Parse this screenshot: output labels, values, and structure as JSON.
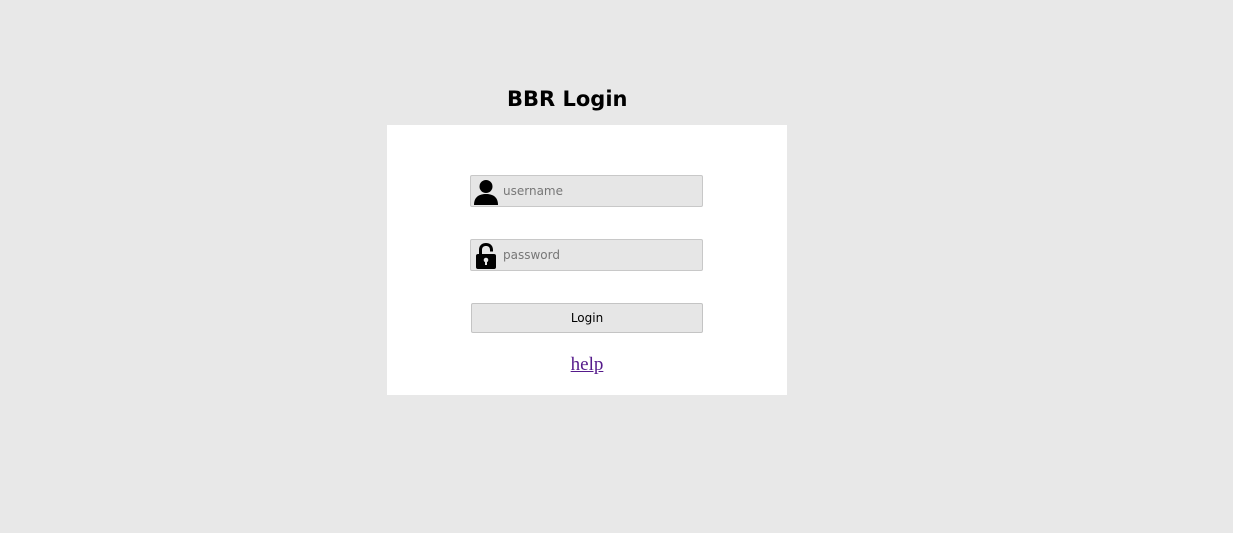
{
  "page": {
    "title": "BBR Login"
  },
  "form": {
    "username_placeholder": "username",
    "username_value": "",
    "username_icon": "user-icon",
    "password_placeholder": "password",
    "password_value": "",
    "password_icon": "unlocked-padlock-icon",
    "login_label": "Login",
    "help_label": "help"
  },
  "colors": {
    "background": "#e8e8e8",
    "panel": "#ffffff",
    "field_background": "#e6e6e6",
    "link": "#551a8b"
  }
}
